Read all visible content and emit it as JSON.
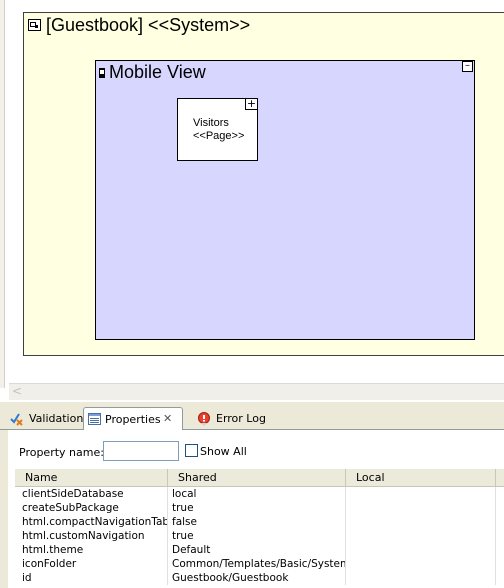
{
  "diagram": {
    "system_title": "[Guestbook] <<System>>",
    "view_title": "Mobile View",
    "view_collapse_glyph": "–",
    "page_name": "Visitors",
    "page_stereotype": "<<Page>>",
    "page_expand_glyph": "+",
    "colors": {
      "system_fill": "#ffffe1",
      "view_fill": "#d6d6ff",
      "page_fill": "#ffffff"
    }
  },
  "scrollbar": {
    "left_arrow": "<"
  },
  "tabs": [
    {
      "label": "Validation",
      "icon": "validation-icon"
    },
    {
      "label": "Properties",
      "icon": "properties-icon",
      "close": "✕",
      "active": true
    },
    {
      "label": "Error Log",
      "icon": "error-log-icon"
    }
  ],
  "properties": {
    "filter_label": "Property name:",
    "filter_value": "",
    "show_all_label": "Show All",
    "show_all_checked": false,
    "columns": [
      "Name",
      "Shared",
      "Local"
    ],
    "rows": [
      {
        "name": "clientSideDatabase",
        "shared": "local",
        "local": ""
      },
      {
        "name": "createSubPackage",
        "shared": "true",
        "local": ""
      },
      {
        "name": "html.compactNavigationTabs",
        "shared": "false",
        "local": ""
      },
      {
        "name": "html.customNavigation",
        "shared": "true",
        "local": ""
      },
      {
        "name": "html.theme",
        "shared": "Default",
        "local": ""
      },
      {
        "name": "iconFolder",
        "shared": "Common/Templates/Basic/System",
        "local": ""
      },
      {
        "name": "id",
        "shared": "Guestbook/Guestbook",
        "local": ""
      }
    ]
  }
}
